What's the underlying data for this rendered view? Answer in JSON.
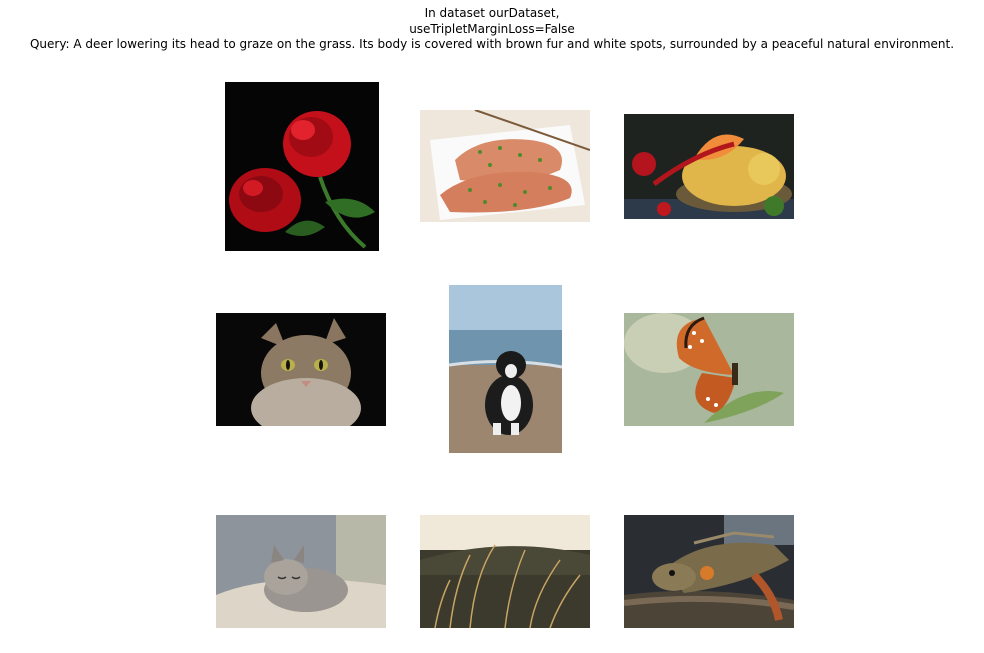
{
  "figure": {
    "title_lines": [
      "In dataset ourDataset,",
      "useTripletMarginLoss=False",
      "Query: A deer lowering its head to graze on the grass. Its body is covered with brown fur and white spots, surrounded by a peaceful natural environment."
    ]
  },
  "grid": {
    "rows": 3,
    "cols": 3,
    "images": [
      {
        "subject": "red roses on black background"
      },
      {
        "subject": "grilled salmon steaks with herbs"
      },
      {
        "subject": "pasta with tomatoes and chili peppers"
      },
      {
        "subject": "tabby cat on black background"
      },
      {
        "subject": "dog sitting on beach"
      },
      {
        "subject": "orange butterfly on leaf"
      },
      {
        "subject": "sleeping kitten on blanket"
      },
      {
        "subject": "dry grass at sunset"
      },
      {
        "subject": "iguana on log"
      }
    ]
  }
}
